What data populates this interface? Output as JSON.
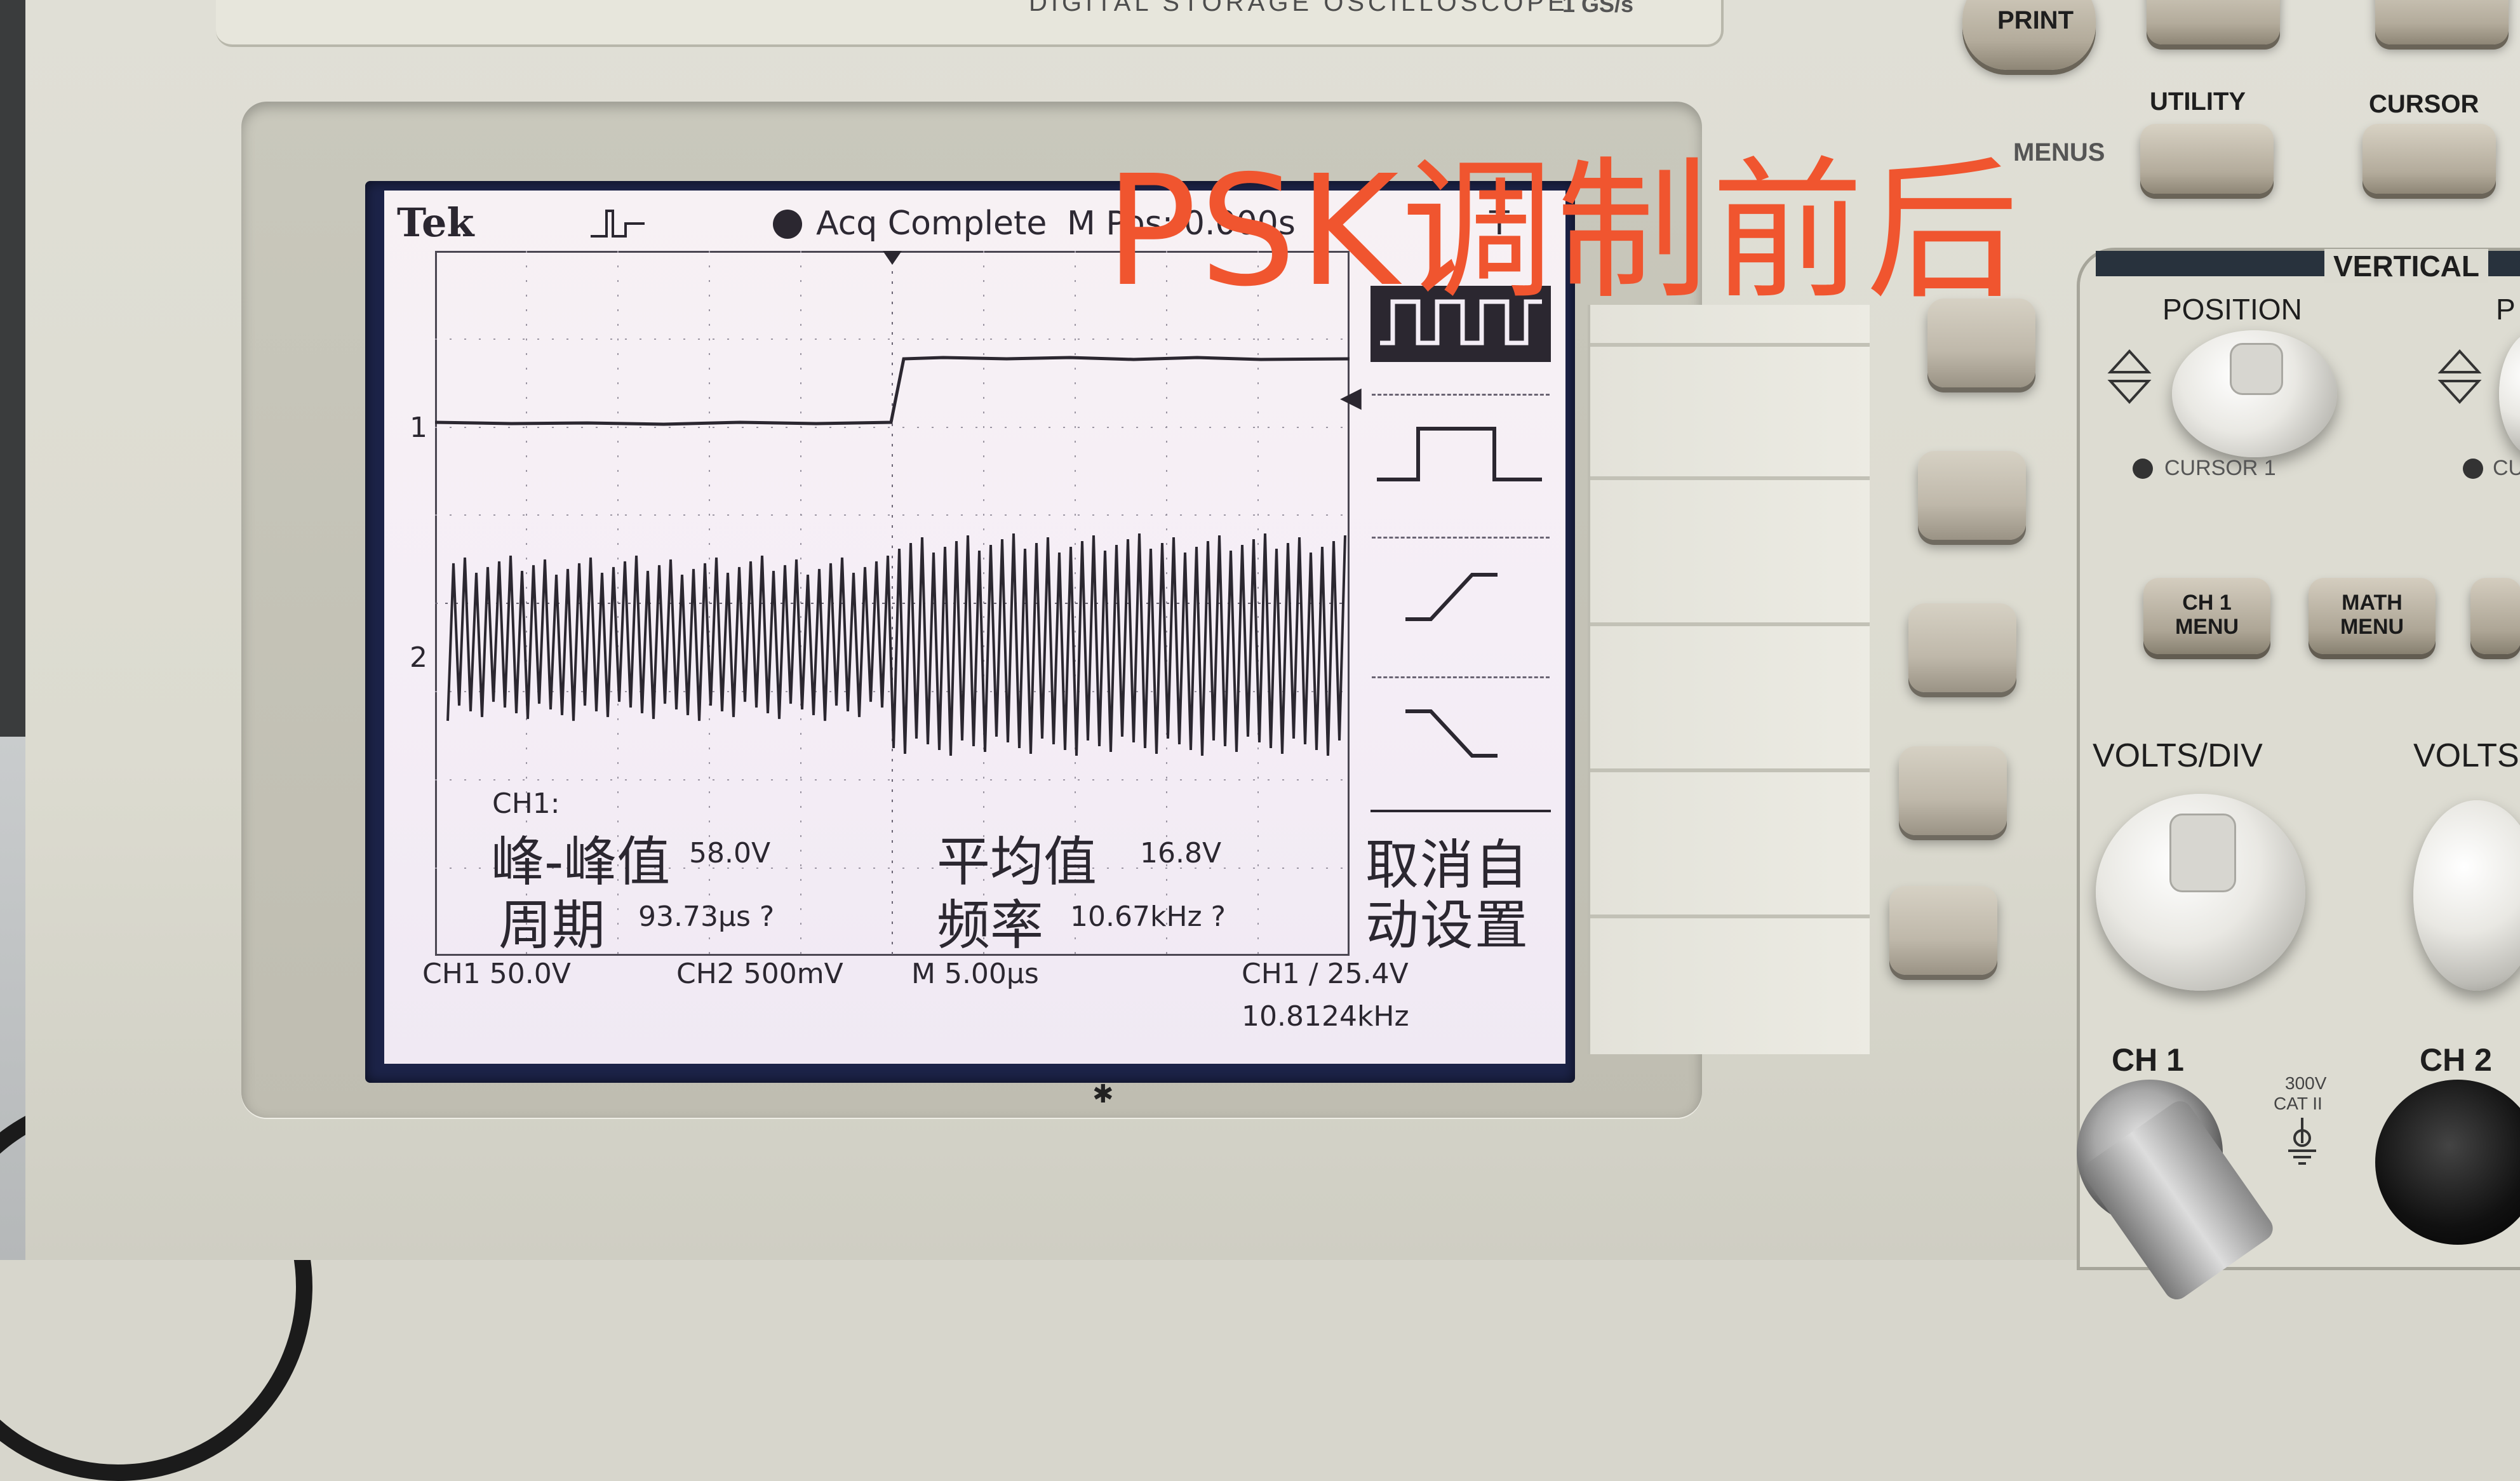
{
  "overlay": {
    "title": "PSK调制前后",
    "color": "#f0552f"
  },
  "device": {
    "model_text": "DIGITAL STORAGE OSCILLOSCOPE",
    "sample_rate": "1 GS/s"
  },
  "screen": {
    "brand": "Tek",
    "acq_status": "Acq Complete",
    "mpos": "M Pos: 0.000s",
    "trig_partial": "T",
    "ch1_marker": "1",
    "ch2_marker": "2",
    "trigger_marker": "◀",
    "measurements": {
      "channel": "CH1:",
      "pk_pk_label": "峰-峰值",
      "pk_pk_value": "58.0V",
      "mean_label": "平均值",
      "mean_value": "16.8V",
      "period_label": "周期",
      "period_value": "93.73μs ?",
      "freq_label": "频率",
      "freq_value": "10.67kHz ?"
    },
    "bottom": {
      "ch1_scale": "CH1  50.0V",
      "ch2_scale": "CH2  500mV",
      "timebase": "M 5.00μs",
      "trigger": "CH1 ∕ 25.4V",
      "trigger_freq": "10.8124kHz"
    },
    "side_menu": {
      "cancel_autoset": [
        "取消自",
        "动设置"
      ]
    }
  },
  "panel": {
    "print": "PRINT",
    "utility": "UTILITY",
    "cursor": "CURSOR",
    "menus": "MENUS",
    "vertical": "VERTICAL",
    "position": "POSITION",
    "position2": "P",
    "cursor1": "CURSOR 1",
    "cursor2": "CU",
    "ch1_menu": [
      "CH 1",
      "MENU"
    ],
    "math_menu": [
      "MATH",
      "MENU"
    ],
    "volts_div": "VOLTS/DIV",
    "volts_div2": "VOLTS",
    "ch1": "CH 1",
    "ch2": "CH 2",
    "cat": [
      "300V",
      "CAT II"
    ]
  }
}
